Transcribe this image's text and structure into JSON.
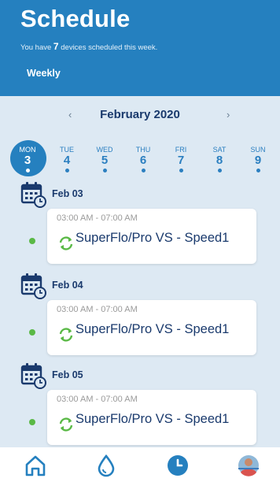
{
  "header": {
    "title": "Schedule",
    "subtitle_prefix": "You have",
    "device_count": "7",
    "subtitle_suffix": "devices scheduled this week.",
    "view_tab": "Weekly"
  },
  "calendar": {
    "prev_icon": "chevron-left-icon",
    "next_icon": "chevron-right-icon",
    "month": "February 2020",
    "days": [
      {
        "name": "MON",
        "num": "3",
        "selected": true
      },
      {
        "name": "TUE",
        "num": "4",
        "selected": false
      },
      {
        "name": "WED",
        "num": "5",
        "selected": false
      },
      {
        "name": "THU",
        "num": "6",
        "selected": false
      },
      {
        "name": "FRI",
        "num": "7",
        "selected": false
      },
      {
        "name": "SAT",
        "num": "8",
        "selected": false
      },
      {
        "name": "SUN",
        "num": "9",
        "selected": false
      }
    ]
  },
  "schedule": [
    {
      "date": "Feb 03",
      "time": "03:00 AM - 07:00 AM",
      "device": "SuperFlo/Pro VS - Speed1"
    },
    {
      "date": "Feb 04",
      "time": "03:00 AM - 07:00 AM",
      "device": "SuperFlo/Pro VS - Speed1"
    },
    {
      "date": "Feb 05",
      "time": "03:00 AM - 07:00 AM",
      "device": "SuperFlo/Pro VS - Speed1"
    }
  ],
  "colors": {
    "primary": "#2580bf",
    "accent_green": "#5ab946",
    "text_dark": "#1a3a6d",
    "background": "#dde9f3"
  },
  "bottom_nav": [
    {
      "icon": "home-icon"
    },
    {
      "icon": "water-drop-icon"
    },
    {
      "icon": "clock-icon",
      "active": true
    },
    {
      "icon": "avatar-icon"
    }
  ]
}
